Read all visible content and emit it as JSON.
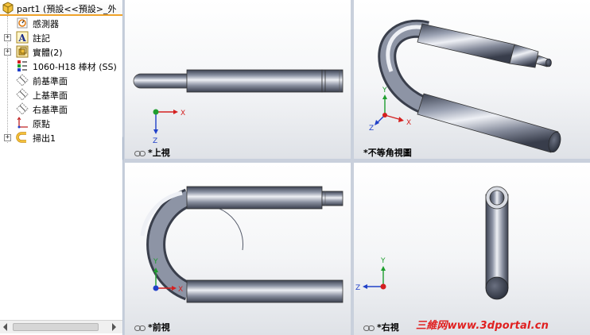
{
  "tree": {
    "header": "part1  (預設<<預設>_外",
    "items": [
      {
        "label": "感測器",
        "icon": "sensor-icon",
        "expandable": false
      },
      {
        "label": "註記",
        "icon": "annotation-icon",
        "expandable": true
      },
      {
        "label": "實體(2)",
        "icon": "solid-bodies-icon",
        "expandable": true
      },
      {
        "label": "1060-H18 棒材 (SS)",
        "icon": "material-icon",
        "expandable": false
      },
      {
        "label": "前基準面",
        "icon": "plane-icon",
        "expandable": false
      },
      {
        "label": "上基準面",
        "icon": "plane-icon",
        "expandable": false
      },
      {
        "label": "右基準面",
        "icon": "plane-icon",
        "expandable": false
      },
      {
        "label": "原點",
        "icon": "origin-icon",
        "expandable": false
      },
      {
        "label": "掃出1",
        "icon": "sweep-icon",
        "expandable": true
      }
    ]
  },
  "views": {
    "top": {
      "label": "*上視"
    },
    "isometric": {
      "label": "*不等角視圖"
    },
    "front": {
      "label": "*前視"
    },
    "right": {
      "label": "*右視"
    }
  },
  "axes": {
    "x": "X",
    "y": "Y",
    "z": "Z"
  },
  "colors": {
    "x_axis": "#d42020",
    "y_axis": "#1e9e2e",
    "z_axis": "#2040c8",
    "header_accent": "#f0a32b"
  },
  "watermark": "三維网www.3dportal.cn"
}
